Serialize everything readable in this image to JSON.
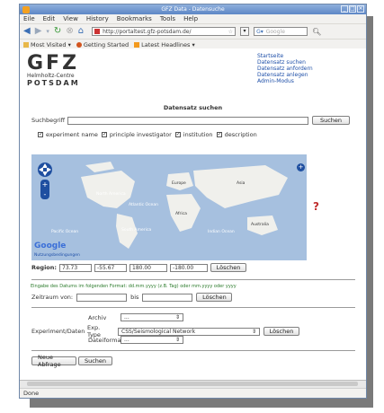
{
  "window": {
    "title": "GFZ Data - Datensuche"
  },
  "menu": [
    "Eile",
    "Edit",
    "View",
    "History",
    "Bookmarks",
    "Tools",
    "Help"
  ],
  "nav": {
    "url": "http://portaltest.gfz-potsdam.de/",
    "search_placeholder": "Google"
  },
  "bookmarks": [
    "Most Visited ▾",
    "Getting Started",
    "Latest Headlines ▾"
  ],
  "logo": {
    "name": "GFZ",
    "line1": "Helmholtz-Centre",
    "line2": "POTSDAM"
  },
  "toplinks": [
    "Startseite",
    "Datensatz suchen",
    "Datensatz anfordern",
    "Datensatz anlegen",
    "Admin-Modus"
  ],
  "search": {
    "title": "Datensatz suchen",
    "label": "Suchbegriff",
    "value": "",
    "button": "Suchen",
    "checks": [
      {
        "label": "experiment name",
        "checked": true
      },
      {
        "label": "principle investigator",
        "checked": true
      },
      {
        "label": "institution",
        "checked": true
      },
      {
        "label": "description",
        "checked": true
      }
    ]
  },
  "map": {
    "labels": {
      "na": "North America",
      "atl": "Atlantic Ocean",
      "sa": "South America",
      "eu": "Europe",
      "af": "Africa",
      "as": "Asia",
      "io": "Indian Ocean",
      "po": "Pacific Ocean",
      "au": "Australia"
    },
    "google": "Google",
    "footer": "Nutzungsbedingungen"
  },
  "region": {
    "label": "Region:",
    "v1": "73.73",
    "v2": "-55.67",
    "v3": "180.00",
    "v4": "-180.00",
    "button": "Löschen"
  },
  "time": {
    "hint": "Eingabe des Datums im folgenden Format: dd.mm.yyyy (z.B. Tag) oder mm.yyyy oder yyyy",
    "from_label": "Zeitraum von:",
    "to_label": "bis",
    "button": "Löschen"
  },
  "exp": {
    "group_label": "Experiment/Daten",
    "archive_label": "Archiv",
    "archive_value": "...",
    "type_label": "Exp. Type",
    "type_value": "CSS/Seismological Network",
    "type_button": "Löschen",
    "format_label": "Dateiformat",
    "format_value": "..."
  },
  "actions": {
    "new": "Neue Abfrage",
    "search": "Suchen"
  },
  "status": "Done"
}
